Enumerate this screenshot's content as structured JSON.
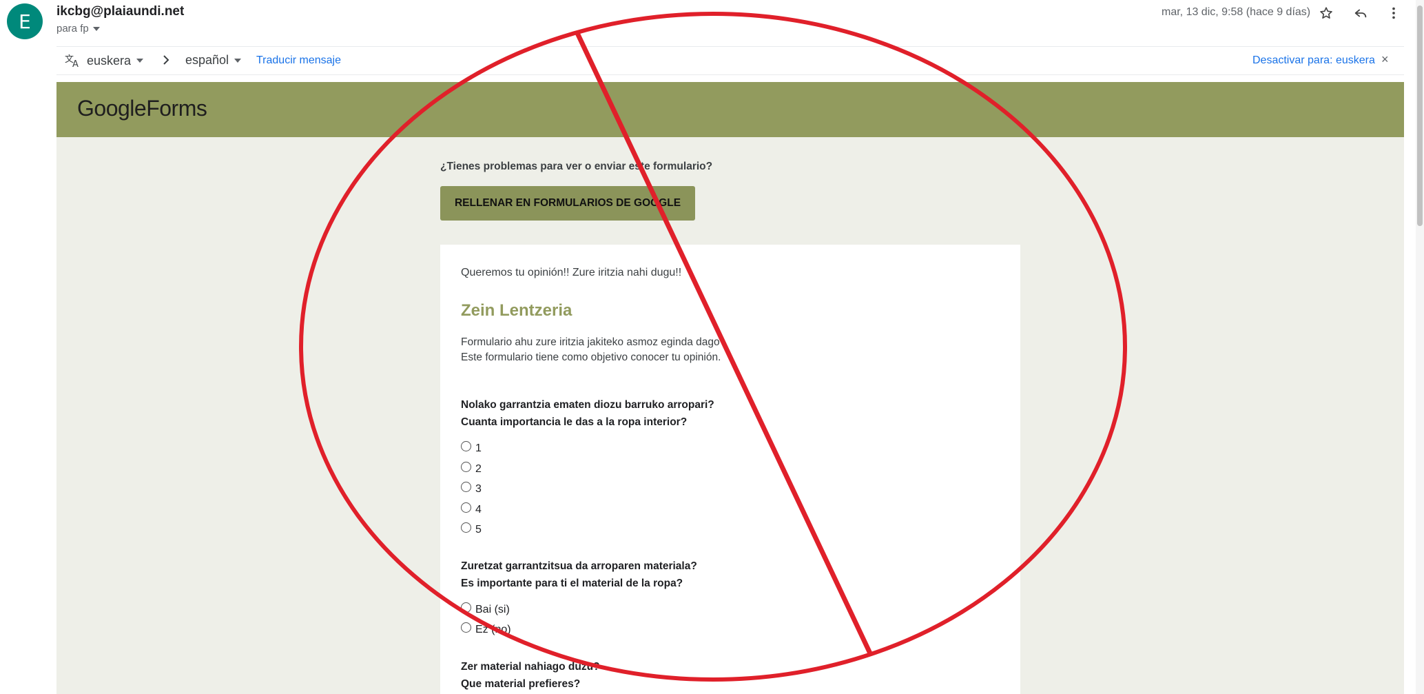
{
  "email": {
    "avatar_letter": "E",
    "sender": "ikcbg@plaiaundi.net",
    "recipients": "para fp",
    "date": "mar, 13 dic, 9:58 (hace 9 días)"
  },
  "translate_bar": {
    "source_lang": "euskera",
    "target_lang": "español",
    "translate_link": "Traducir mensaje",
    "disable_link": "Desactivar para: euskera",
    "close_glyph": "×"
  },
  "forms": {
    "logo_google": "Google",
    "logo_forms": "Forms",
    "problems_text": "¿Tienes problemas para ver o enviar este formulario?",
    "fill_button": "RELLENAR EN FORMULARIOS DE GOOGLE",
    "intro": "Queremos tu opinión!! Zure iritzia nahi dugu!!",
    "title": "Zein Lentzeria",
    "description_line1": "Formulario ahu zure iritzia jakiteko asmoz eginda dago .",
    "description_line2": "Este formulario tiene como objetivo conocer tu opinión.",
    "q1_line1": "Nolako garrantzia ematen diozu barruko arropari?",
    "q1_line2": "Cuanta importancia le das a la ropa interior?",
    "q1_options": [
      "1",
      "2",
      "3",
      "4",
      "5"
    ],
    "q2_line1": "Zuretzat garrantzitsua da arroparen materiala?",
    "q2_line2": "Es importante para ti el material de la ropa?",
    "q2_options": [
      "Bai (si)",
      "Ez (no)"
    ],
    "q3_line1": "Zer material nahiago duzu?",
    "q3_line2": "Que material prefieres?"
  },
  "colors": {
    "accent": "#929b5e",
    "button": "#8b945a",
    "overlay_red": "#e0202a"
  }
}
